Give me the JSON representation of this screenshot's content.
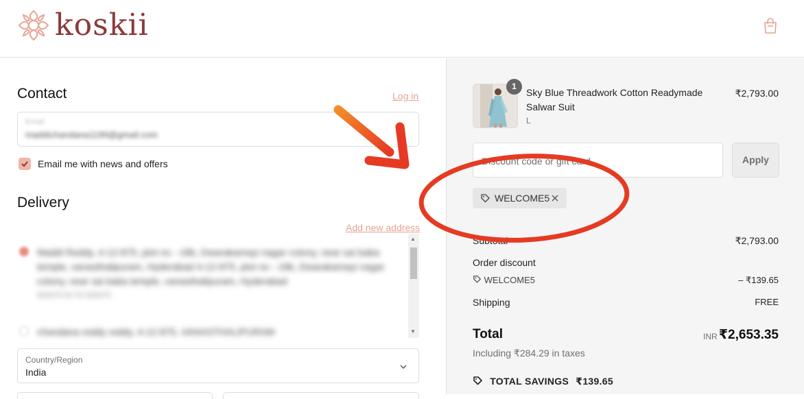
{
  "brand": {
    "name": "koskii",
    "color": "#8b3a3a"
  },
  "header": {
    "cart_icon": "shopping-bag-icon"
  },
  "contact": {
    "title": "Contact",
    "login_link": "Log in",
    "email_label": "Email",
    "email_value": "maddichandana1199@gmail.com",
    "newsletter_label": "Email me with news and offers",
    "newsletter_checked": true
  },
  "delivery": {
    "title": "Delivery",
    "add_address_link": "Add new address",
    "addresses": [
      {
        "line1": "Maddi Reddy, 4-12-875, plot no - 18b, Dwarakamayi nagar colony, near sai baba",
        "line2": "temple, vanasthalipuram, Hyderabad 4-12-875, plot no - 18b, Dwarakamayi nagar",
        "line3": "colony, near sai baba temple, vanasthalipuram, Hyderabad",
        "line4": "500070 IN TS 500070"
      },
      {
        "line1": "chandana reddy reddy, 4-12-875, VANASTHALIPURAM"
      }
    ],
    "country_label": "Country/Region",
    "country_value": "India"
  },
  "summary": {
    "product": {
      "name": "Sky Blue Threadwork Cotton Readymade Salwar Suit",
      "variant": "L",
      "price": "₹2,793.00",
      "quantity": "1"
    },
    "discount_placeholder": "Discount code or gift card",
    "apply_label": "Apply",
    "applied_code": "WELCOME5",
    "subtotal_label": "Subtotal",
    "subtotal_value": "₹2,793.00",
    "order_discount_label": "Order discount",
    "order_discount_code": "WELCOME5",
    "order_discount_value": "– ₹139.65",
    "shipping_label": "Shipping",
    "shipping_value": "FREE",
    "total_label": "Total",
    "currency": "INR",
    "total_value": "₹2,653.35",
    "tax_note": "Including ₹284.29 in taxes",
    "savings_label": "TOTAL SAVINGS",
    "savings_value": "₹139.65"
  },
  "annotation_color": "#e63a23",
  "accent_color": "#f2b5aa"
}
